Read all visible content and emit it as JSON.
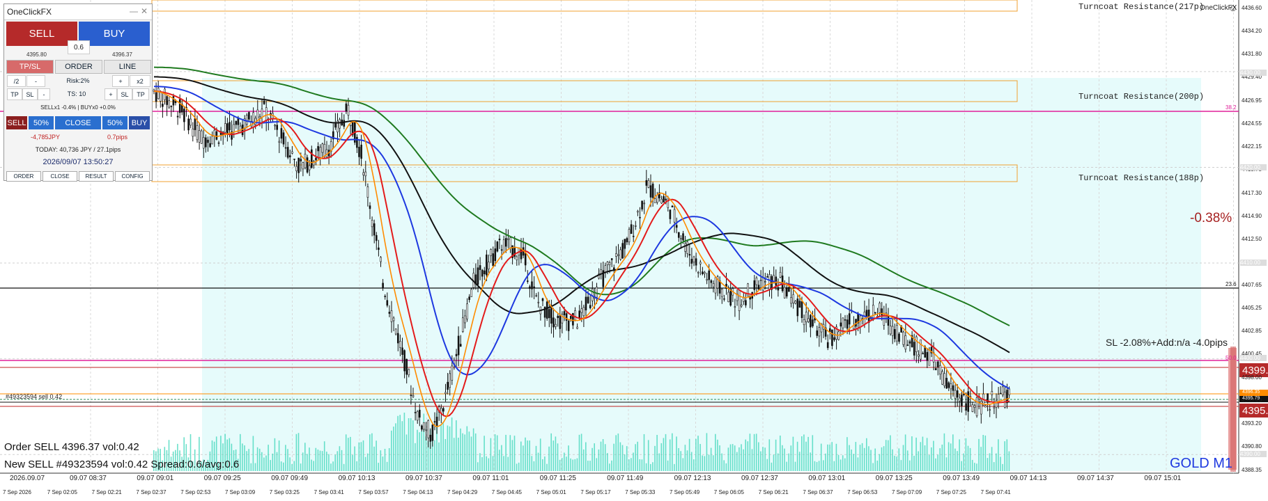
{
  "panel": {
    "title": "OneClickFX",
    "sell_label": "SELL",
    "buy_label": "BUY",
    "lot": "0.6",
    "sell_price": "4395.80",
    "buy_price": "4396.37",
    "tabs": [
      "TP/SL",
      "ORDER",
      "LINE"
    ],
    "risk_row": [
      "/2",
      "-",
      "Risk:2%",
      "+",
      "x2"
    ],
    "ts_row": [
      "TP",
      "SL",
      "-",
      "TS: 10",
      "+",
      "SL",
      "TP"
    ],
    "position_info": "SELLx1 -0.4% | BUYx0 +0.0%",
    "close_row": [
      "SELL",
      "50%",
      "CLOSE",
      "50%",
      "BUY"
    ],
    "pnl_jpy": "-4,785JPY",
    "pnl_pips": "0.7pips",
    "today": "TODAY: 40,736 JPY / 27.1pips",
    "datetime": "2026/09/07   13:50:27",
    "footer": [
      "ORDER",
      "CLOSE",
      "RESULT",
      "CONFIG"
    ]
  },
  "chart": {
    "brand": "OneClickFX",
    "symbol_label": "GOLD M1",
    "change_pct": "-0.38%",
    "sl_info": "SL -2.08%+Add:n/a -4.0pips",
    "order_line1": "Order SELL 4396.37 vol:0.42",
    "order_line2": "New SELL #49323594 vol:0.42 Spread:0.6/avg:0.6",
    "order_tag": "#49323594 sell 0.42",
    "resistances": [
      "Turncoat Resistance(217p)",
      "Turncoat Resistance(200p)",
      "Turncoat Resistance(188p)"
    ],
    "fib_labels": [
      "38.2",
      "23.6",
      "50.0"
    ],
    "price_ticks": [
      "4436.60",
      "4434.20",
      "4431.80",
      "4429.40",
      "4426.95",
      "4424.55",
      "4422.15",
      "4419.75",
      "4417.30",
      "4414.90",
      "4412.50",
      "4410.10",
      "4407.65",
      "4405.25",
      "4402.85",
      "4400.45",
      "4398.00",
      "4395.60",
      "4393.20",
      "4390.80",
      "4388.35"
    ],
    "price_box_tags": [
      "4430.00",
      "4420.00",
      "4410.00",
      "4400.00",
      "4390.00"
    ],
    "current_tags": {
      "red_top": "4399.",
      "green": "4396.35",
      "black": "4395.79",
      "red_bottom": "4395."
    },
    "top_time_labels": [
      "2026.09.07",
      "09.07 08:37",
      "09.07 09:01",
      "09.07 09:25",
      "09.07 09:49",
      "09.07 10:13",
      "09.07 10:37",
      "09.07 11:01",
      "09.07 11:25",
      "09.07 11:49",
      "09.07 12:13",
      "09.07 12:37",
      "09.07 13:01",
      "09.07 13:25",
      "09.07 13:49",
      "09.07 14:13",
      "09.07 14:37",
      "09.07 15:01"
    ],
    "bottom_time_labels": [
      "7 Sep 2026",
      "7 Sep 02:05",
      "7 Sep 02:21",
      "7 Sep 02:37",
      "7 Sep 02:53",
      "7 Sep 03:09",
      "7 Sep 03:25",
      "7 Sep 03:41",
      "7 Sep 03:57",
      "7 Sep 04:13",
      "7 Sep 04:29",
      "7 Sep 04:45",
      "7 Sep 05:01",
      "7 Sep 05:17",
      "7 Sep 05:33",
      "7 Sep 05:49",
      "7 Sep 06:05",
      "7 Sep 06:21",
      "7 Sep 06:37",
      "7 Sep 06:53",
      "7 Sep 07:09",
      "7 Sep 07:25",
      "7 Sep 07:41"
    ],
    "colors": {
      "sell": "#b52a2a",
      "buy": "#2a5fcf",
      "cyan_zone": "#e6fbfb",
      "ma_red": "#e31b1b",
      "ma_orange": "#ff8c00",
      "ma_blue": "#1d38e0",
      "ma_black": "#111111",
      "ma_green": "#1f7a1f",
      "magenta": "#e0209a"
    }
  }
}
